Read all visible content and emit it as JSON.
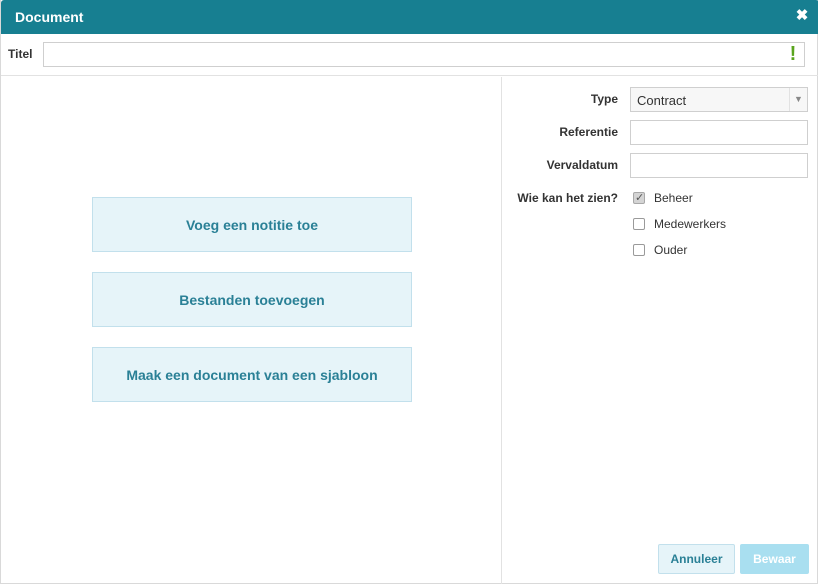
{
  "dialog": {
    "title": "Document",
    "close_icon": "close-icon"
  },
  "title_field": {
    "label": "Titel",
    "value": "",
    "placeholder": "",
    "warning_glyph": "!",
    "warning_color": "#5aa51e"
  },
  "actions": [
    {
      "label": "Voeg een notitie toe"
    },
    {
      "label": "Bestanden toevoegen"
    },
    {
      "label": "Maak een document van een sjabloon"
    }
  ],
  "form": {
    "type_label": "Type",
    "type_value": "Contract",
    "reference_label": "Referentie",
    "reference_value": "",
    "due_label": "Vervaldatum",
    "due_value": "",
    "visibility_label": "Wie kan het zien?",
    "visibility_options": [
      {
        "label": "Beheer",
        "checked": true
      },
      {
        "label": "Medewerkers",
        "checked": false
      },
      {
        "label": "Ouder",
        "checked": false
      }
    ]
  },
  "footer": {
    "cancel_label": "Annuleer",
    "save_label": "Bewaar"
  },
  "colors": {
    "header": "#177f91",
    "accent_text": "#2a8096",
    "button_bg": "#e6f4f9",
    "save_disabled_bg": "#a9dff0"
  }
}
